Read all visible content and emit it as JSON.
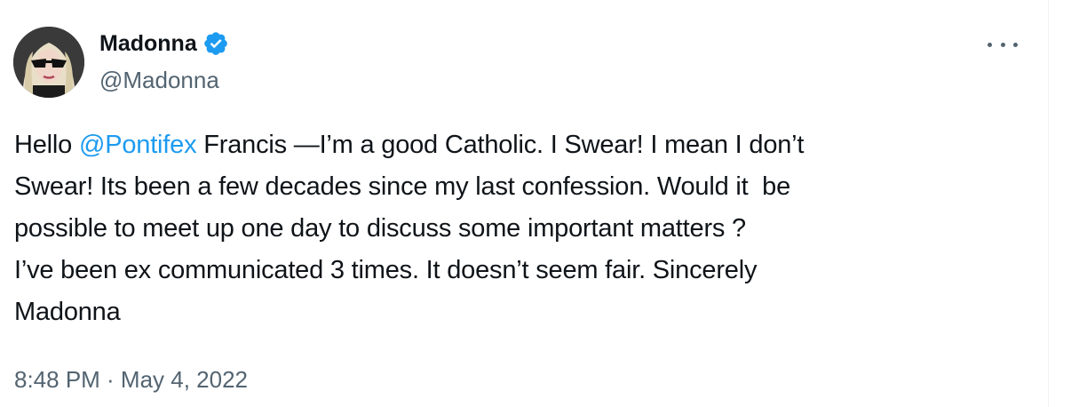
{
  "author": {
    "display_name": "Madonna",
    "handle": "@Madonna",
    "verified": true
  },
  "more_icon": "more-horizontal-icon",
  "tweet": {
    "line1_before": "Hello ",
    "mention": "@Pontifex",
    "line1_after": " Francis —I’m a good Catholic. I Swear! I mean I don’t",
    "line2": "Swear! Its been a few decades since my last confession. Would it  be",
    "line3": "possible to meet up one day to discuss some important matters ?",
    "line4": "I’ve been ex communicated 3 times. It doesn’t seem fair. Sincerely",
    "line5": "Madonna"
  },
  "timestamp": "8:48 PM · May 4, 2022",
  "colors": {
    "text": "#0f1419",
    "secondary": "#536471",
    "link": "#1d9bf0",
    "verified": "#1d9bf0"
  }
}
